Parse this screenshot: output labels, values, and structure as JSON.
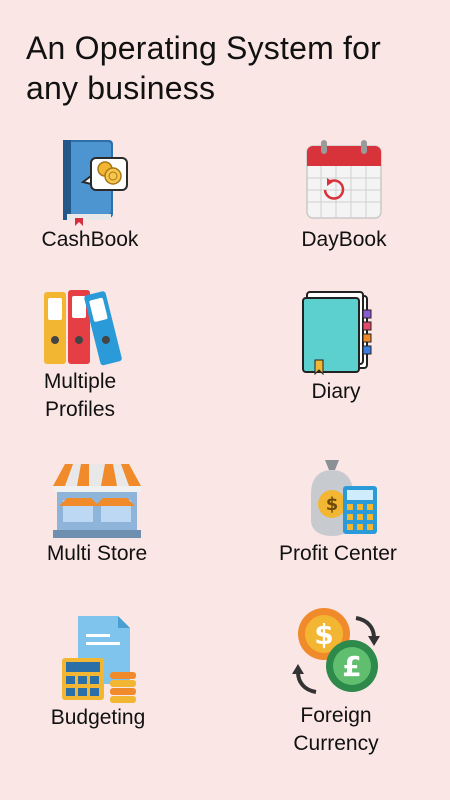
{
  "headline": {
    "line1": "An Operating System for",
    "line2": "any business"
  },
  "features": [
    {
      "id": "cashbook",
      "icon": "cashbook-book-coins-icon",
      "lines": [
        "CashBook"
      ]
    },
    {
      "id": "daybook",
      "icon": "calendar-icon",
      "lines": [
        "DayBook"
      ]
    },
    {
      "id": "multiple-profiles",
      "icon": "binders-icon",
      "lines": [
        "Multiple",
        "Profiles"
      ]
    },
    {
      "id": "diary",
      "icon": "diary-notebook-icon",
      "lines": [
        "Diary"
      ]
    },
    {
      "id": "multi-store",
      "icon": "storefront-icon",
      "lines": [
        "Multi Store"
      ]
    },
    {
      "id": "profit-center",
      "icon": "money-bag-calculator-icon",
      "lines": [
        "Profit Center"
      ]
    },
    {
      "id": "budgeting",
      "icon": "document-calculator-coins-icon",
      "lines": [
        "Budgeting"
      ]
    },
    {
      "id": "foreign-currency",
      "icon": "currency-exchange-icon",
      "lines": [
        "Foreign",
        "Currency"
      ]
    }
  ]
}
